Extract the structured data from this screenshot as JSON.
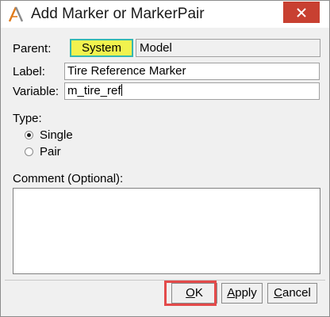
{
  "window": {
    "title": "Add Marker or MarkerPair",
    "close_glyph": "✕",
    "app_icon": "hyperworks-logo-icon",
    "close_color": "#c84031"
  },
  "form": {
    "parent_label": "Parent:",
    "parent_options": {
      "system": "System",
      "model": "Model"
    },
    "label_label": "Label:",
    "label_value": "Tire Reference Marker",
    "variable_label": "Variable:",
    "variable_value": "m_tire_ref",
    "type_label": "Type:",
    "type_options": [
      {
        "label": "Single",
        "checked": true
      },
      {
        "label": "Pair",
        "checked": false
      }
    ],
    "comment_label": "Comment (Optional):",
    "comment_value": ""
  },
  "buttons": {
    "ok": {
      "ul": "O",
      "rest": "K"
    },
    "apply": {
      "ul": "A",
      "rest": "pply"
    },
    "cancel": {
      "ul": "C",
      "rest": "ancel"
    }
  },
  "colors": {
    "system_selected_bg": "#f2f24e",
    "system_selected_border": "#35b7b0",
    "highlight": "#e34a4a"
  }
}
